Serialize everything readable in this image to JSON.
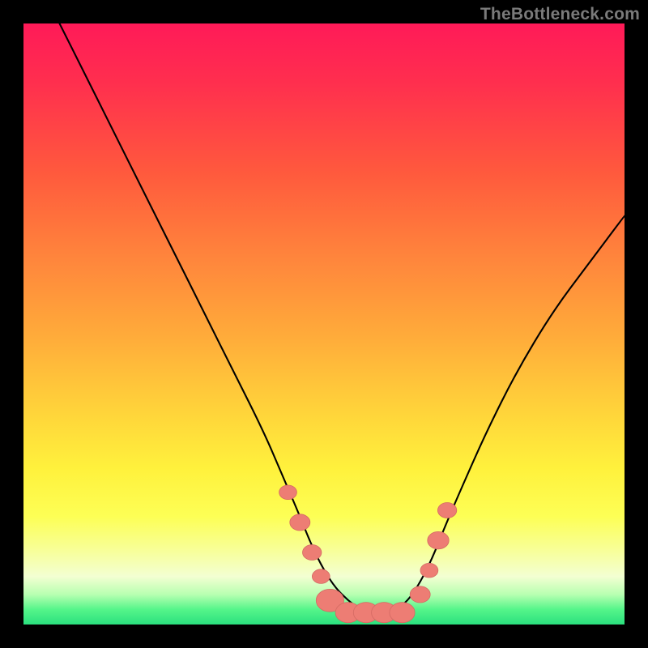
{
  "watermark": "TheBottleneck.com",
  "colors": {
    "frame": "#000000",
    "curve": "#000000",
    "marker_fill": "#ed7d74",
    "marker_stroke": "#d46a63"
  },
  "chart_data": {
    "type": "line",
    "title": "",
    "xlabel": "",
    "ylabel": "",
    "xlim": [
      0,
      100
    ],
    "ylim": [
      0,
      100
    ],
    "grid": false,
    "legend": false,
    "series": [
      {
        "name": "left-branch",
        "comment": "Steep descending limb from upper-left to valley floor; x is % of plot width, y is % of plot height from bottom.",
        "x": [
          6,
          10,
          15,
          20,
          25,
          30,
          35,
          40,
          43,
          46,
          48,
          50,
          52,
          54,
          56,
          58,
          60
        ],
        "values": [
          100,
          92,
          82,
          72,
          62,
          52,
          42,
          32,
          25,
          18,
          13,
          9,
          6,
          4,
          2.5,
          2,
          2
        ]
      },
      {
        "name": "right-branch",
        "comment": "Shallower ascending limb from valley floor to upper-right.",
        "x": [
          60,
          62,
          64,
          66,
          68,
          70,
          73,
          77,
          82,
          88,
          94,
          100
        ],
        "values": [
          2,
          2.5,
          4,
          7,
          11,
          16,
          23,
          32,
          42,
          52,
          60,
          68
        ]
      }
    ],
    "markers": {
      "comment": "Pink blob markers near the valley on both limbs and along the flat bottom.",
      "points": [
        {
          "x": 44,
          "y": 22,
          "r": 1.4
        },
        {
          "x": 46,
          "y": 17,
          "r": 1.6
        },
        {
          "x": 48,
          "y": 12,
          "r": 1.5
        },
        {
          "x": 49.5,
          "y": 8,
          "r": 1.4
        },
        {
          "x": 51,
          "y": 4,
          "r": 2.2
        },
        {
          "x": 54,
          "y": 2,
          "r": 2.0
        },
        {
          "x": 57,
          "y": 2,
          "r": 2.0
        },
        {
          "x": 60,
          "y": 2,
          "r": 2.0
        },
        {
          "x": 63,
          "y": 2,
          "r": 2.0
        },
        {
          "x": 66,
          "y": 5,
          "r": 1.6
        },
        {
          "x": 67.5,
          "y": 9,
          "r": 1.4
        },
        {
          "x": 69,
          "y": 14,
          "r": 1.7
        },
        {
          "x": 70.5,
          "y": 19,
          "r": 1.5
        }
      ]
    }
  }
}
